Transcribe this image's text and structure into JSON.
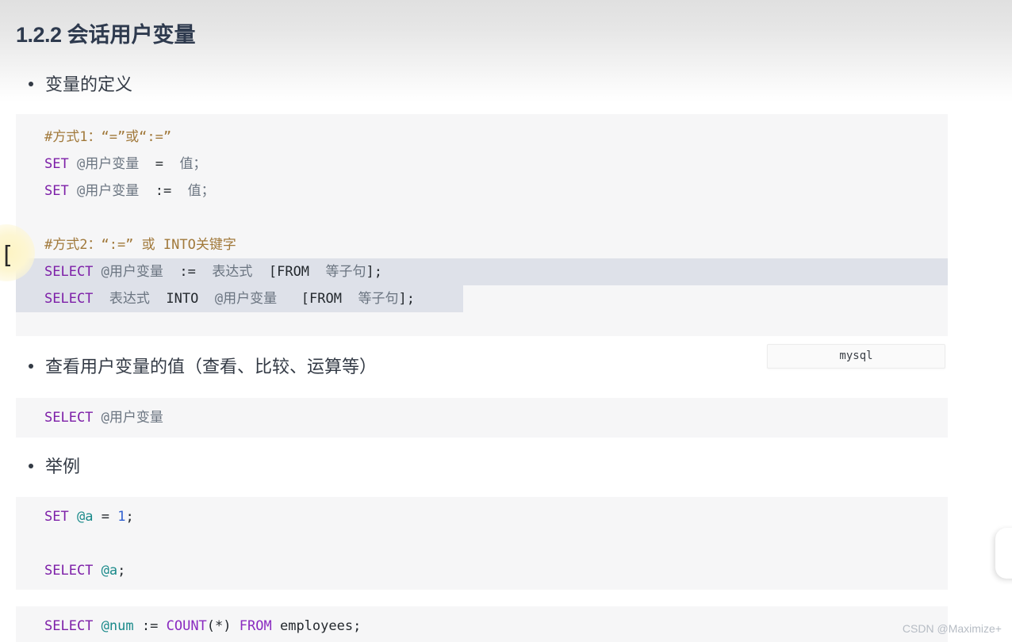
{
  "page": {
    "title_number": "1.2.2",
    "title_text": "会话用户变量",
    "watermark": "CSDN @Maximize+"
  },
  "bullets": [
    {
      "label": "变量的定义"
    },
    {
      "label": "查看用户变量的值（查看、比较、运算等）"
    },
    {
      "label": "举例"
    }
  ],
  "badge": {
    "label": "mysql"
  },
  "artifacts": {
    "caret": "["
  },
  "code_blocks": [
    {
      "id": "code-block-1",
      "lines": [
        {
          "selected": false,
          "tokens": [
            {
              "t": "#方式1：“=”或“:=”",
              "c": "comment"
            }
          ]
        },
        {
          "selected": false,
          "tokens": [
            {
              "t": "SET",
              "c": "kw"
            },
            {
              "t": " ",
              "c": "plain"
            },
            {
              "t": "@用户变量",
              "c": "zh"
            },
            {
              "t": "  ",
              "c": "plain"
            },
            {
              "t": "=",
              "c": "op"
            },
            {
              "t": "  ",
              "c": "plain"
            },
            {
              "t": "值；",
              "c": "zh"
            }
          ]
        },
        {
          "selected": false,
          "tokens": [
            {
              "t": "SET",
              "c": "kw"
            },
            {
              "t": " ",
              "c": "plain"
            },
            {
              "t": "@用户变量",
              "c": "zh"
            },
            {
              "t": "  ",
              "c": "plain"
            },
            {
              "t": ":=",
              "c": "op"
            },
            {
              "t": "  ",
              "c": "plain"
            },
            {
              "t": "值；",
              "c": "zh"
            }
          ]
        },
        {
          "selected": false,
          "blank": true,
          "tokens": [
            {
              "t": " ",
              "c": "plain"
            }
          ]
        },
        {
          "selected": false,
          "tokens": [
            {
              "t": "#方式2：“:=” 或 INTO关键字",
              "c": "comment"
            }
          ]
        },
        {
          "selected": true,
          "sel_width": "full",
          "tokens": [
            {
              "t": "SELECT",
              "c": "kw"
            },
            {
              "t": " ",
              "c": "plain"
            },
            {
              "t": "@用户变量",
              "c": "zh"
            },
            {
              "t": "  ",
              "c": "plain"
            },
            {
              "t": ":=",
              "c": "op"
            },
            {
              "t": "  ",
              "c": "plain"
            },
            {
              "t": "表达式",
              "c": "zh"
            },
            {
              "t": "  ",
              "c": "plain"
            },
            {
              "t": "[FROM",
              "c": "plain"
            },
            {
              "t": "  ",
              "c": "plain"
            },
            {
              "t": "等子句",
              "c": "zh"
            },
            {
              "t": "];",
              "c": "plain"
            }
          ]
        },
        {
          "selected": true,
          "sel_width": "part",
          "tokens": [
            {
              "t": "SELECT",
              "c": "kw"
            },
            {
              "t": "  ",
              "c": "plain"
            },
            {
              "t": "表达式",
              "c": "zh"
            },
            {
              "t": "  ",
              "c": "plain"
            },
            {
              "t": "INTO",
              "c": "plain"
            },
            {
              "t": "  ",
              "c": "plain"
            },
            {
              "t": "@用户变量",
              "c": "zh"
            },
            {
              "t": "   ",
              "c": "plain"
            },
            {
              "t": "[FROM",
              "c": "plain"
            },
            {
              "t": "  ",
              "c": "plain"
            },
            {
              "t": "等子句",
              "c": "zh"
            },
            {
              "t": "];",
              "c": "plain"
            }
          ]
        }
      ]
    },
    {
      "id": "code-block-2",
      "lines": [
        {
          "selected": false,
          "tokens": [
            {
              "t": "SELECT",
              "c": "kw"
            },
            {
              "t": " ",
              "c": "plain"
            },
            {
              "t": "@用户变量",
              "c": "zh"
            }
          ]
        }
      ]
    },
    {
      "id": "code-block-3",
      "lines": [
        {
          "selected": false,
          "tokens": [
            {
              "t": "SET",
              "c": "kw"
            },
            {
              "t": " ",
              "c": "plain"
            },
            {
              "t": "@a",
              "c": "var"
            },
            {
              "t": " ",
              "c": "plain"
            },
            {
              "t": "=",
              "c": "op"
            },
            {
              "t": " ",
              "c": "plain"
            },
            {
              "t": "1",
              "c": "num"
            },
            {
              "t": ";",
              "c": "plain"
            }
          ]
        },
        {
          "selected": false,
          "blank": true,
          "tokens": [
            {
              "t": " ",
              "c": "plain"
            }
          ]
        },
        {
          "selected": false,
          "tokens": [
            {
              "t": "SELECT",
              "c": "kw"
            },
            {
              "t": " ",
              "c": "plain"
            },
            {
              "t": "@a",
              "c": "var"
            },
            {
              "t": ";",
              "c": "plain"
            }
          ]
        }
      ]
    },
    {
      "id": "code-block-4",
      "lines": [
        {
          "selected": false,
          "tokens": [
            {
              "t": "SELECT",
              "c": "kw"
            },
            {
              "t": " ",
              "c": "plain"
            },
            {
              "t": "@num",
              "c": "var"
            },
            {
              "t": " ",
              "c": "plain"
            },
            {
              "t": ":=",
              "c": "op"
            },
            {
              "t": " ",
              "c": "plain"
            },
            {
              "t": "COUNT",
              "c": "kw2"
            },
            {
              "t": "(*)",
              "c": "plain"
            },
            {
              "t": " ",
              "c": "plain"
            },
            {
              "t": "FROM",
              "c": "kw2"
            },
            {
              "t": " ",
              "c": "plain"
            },
            {
              "t": "employees",
              "c": "plain"
            },
            {
              "t": ";",
              "c": "plain"
            }
          ]
        }
      ]
    }
  ]
}
